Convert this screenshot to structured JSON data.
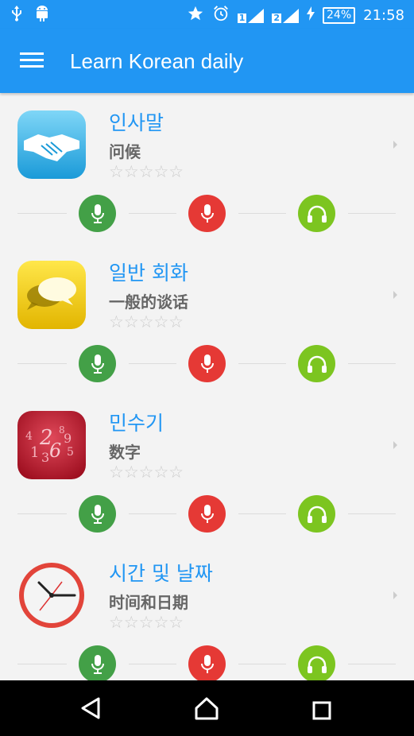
{
  "status_bar": {
    "sim1_badge": "1",
    "sim2_badge": "2",
    "battery": "24%",
    "time": "21:58",
    "icons": [
      "usb-icon",
      "android-icon",
      "star-icon",
      "alarm-icon",
      "signal-icon",
      "charging-icon"
    ]
  },
  "app_bar": {
    "title": "Learn Korean daily",
    "menu_icon": "hamburger-icon",
    "color": "#2196f3"
  },
  "lessons": [
    {
      "korean": "인사말",
      "chinese": "问候",
      "stars": "☆☆☆☆☆",
      "icon": "handshake-icon"
    },
    {
      "korean": "일반 회화",
      "chinese": "一般的谈话",
      "stars": "☆☆☆☆☆",
      "icon": "chat-bubbles-icon"
    },
    {
      "korean": "민수기",
      "chinese": "数字",
      "stars": "☆☆☆☆☆",
      "icon": "numbers-icon"
    },
    {
      "korean": "시간 및 날짜",
      "chinese": "时间和日期",
      "stars": "☆☆☆☆☆",
      "icon": "clock-icon"
    }
  ],
  "actions": {
    "record_color": "#43a047",
    "speak_color": "#e53935",
    "listen_color": "#7cc520"
  },
  "nav_bar": {
    "icons": [
      "back-icon",
      "home-icon",
      "recents-icon"
    ]
  }
}
